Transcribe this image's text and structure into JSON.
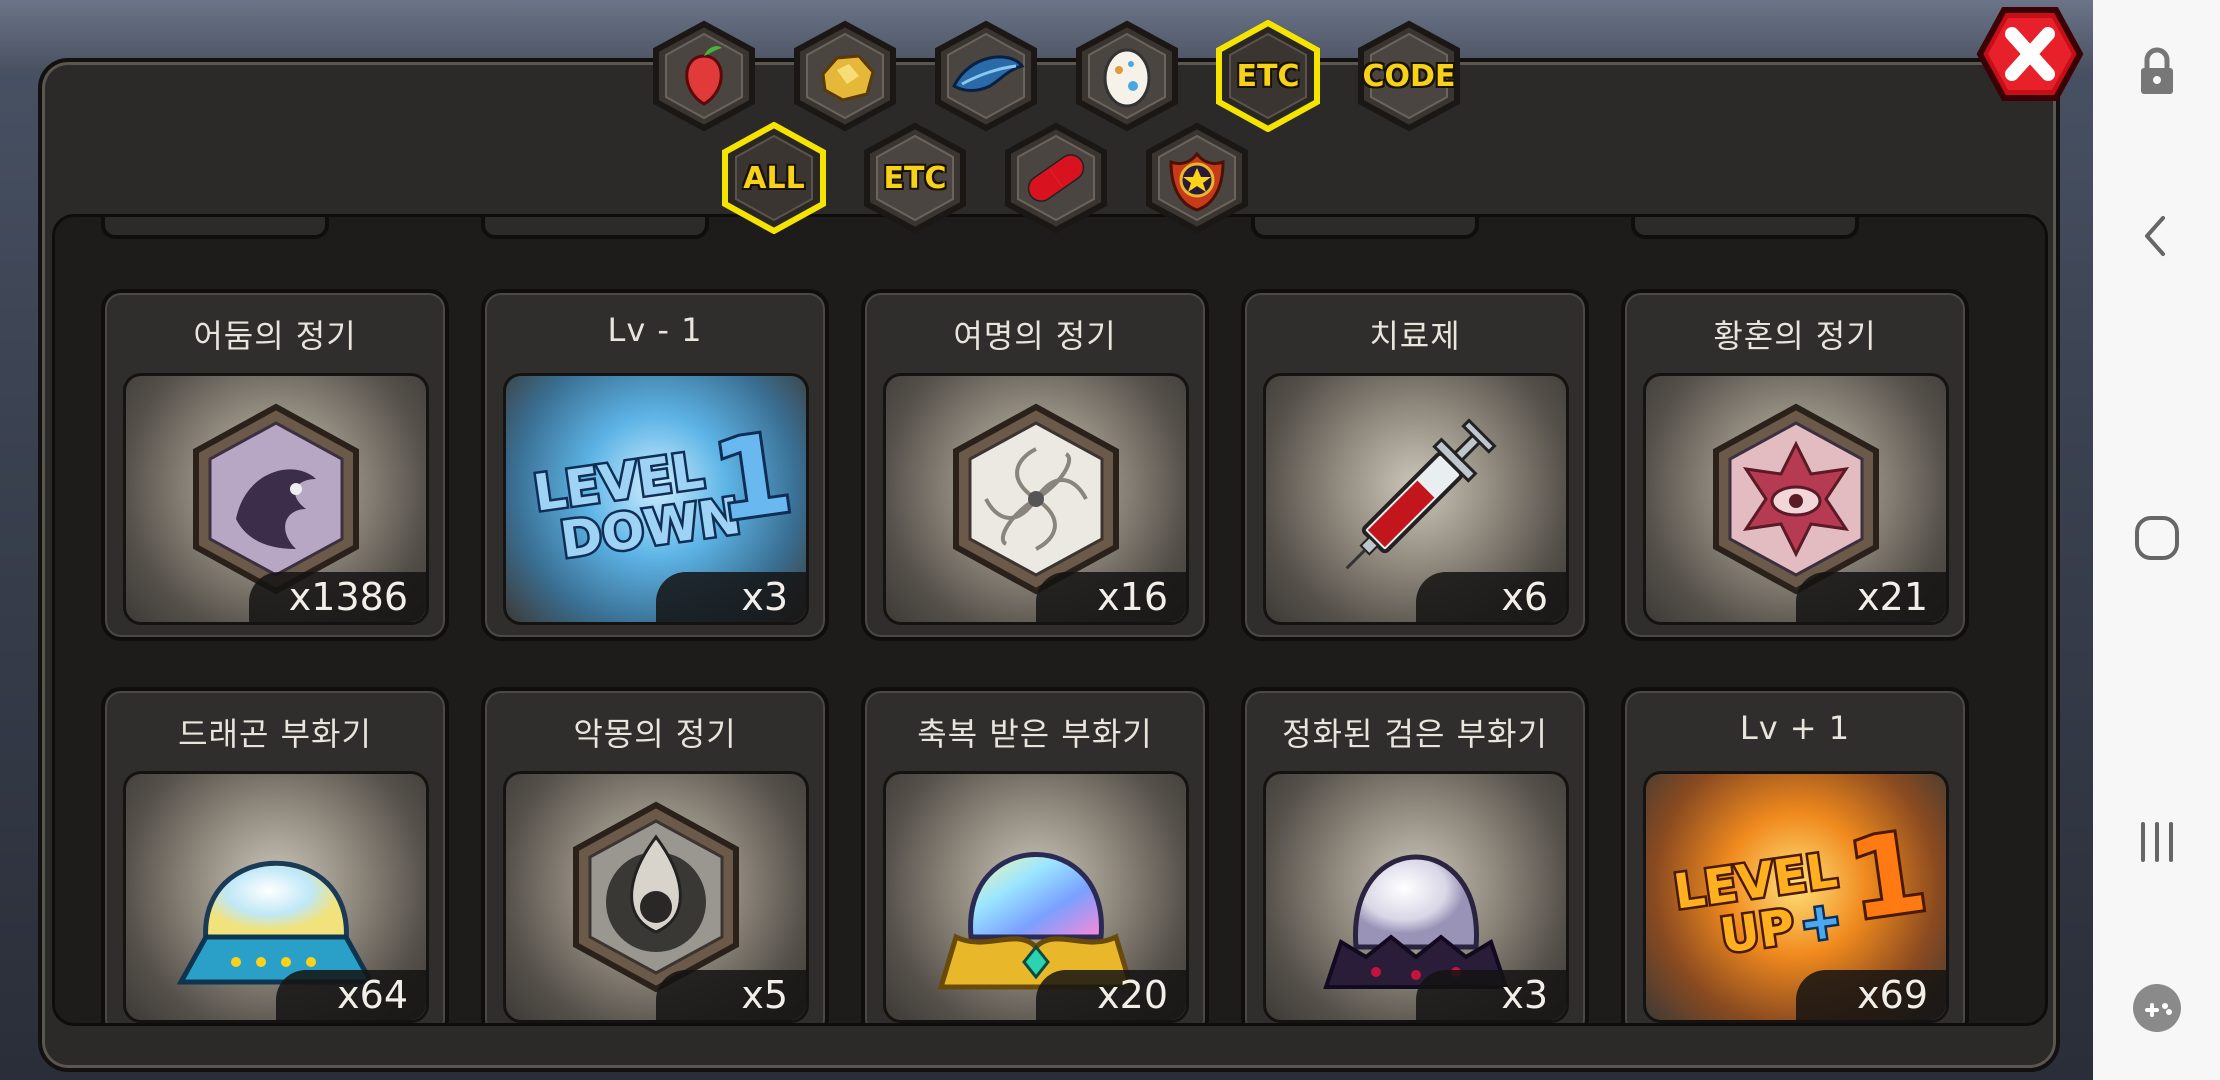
{
  "tabs_top": [
    {
      "id": "fruit",
      "label": "",
      "icon": "fruit-icon",
      "selected": false
    },
    {
      "id": "ore",
      "label": "",
      "icon": "ore-icon",
      "selected": false
    },
    {
      "id": "feather",
      "label": "",
      "icon": "feather-icon",
      "selected": false
    },
    {
      "id": "egg",
      "label": "",
      "icon": "egg-icon",
      "selected": false
    },
    {
      "id": "etc",
      "label": "ETC",
      "icon": "",
      "selected": true
    },
    {
      "id": "code",
      "label": "CODE",
      "icon": "",
      "selected": false
    }
  ],
  "tabs_sub": [
    {
      "id": "all",
      "label": "ALL",
      "icon": "",
      "selected": true
    },
    {
      "id": "etc",
      "label": "ETC",
      "icon": "",
      "selected": false
    },
    {
      "id": "pill",
      "label": "",
      "icon": "pill-icon",
      "selected": false
    },
    {
      "id": "badge",
      "label": "",
      "icon": "star-badge-icon",
      "selected": false
    }
  ],
  "items": [
    {
      "title": "어둠의 정기",
      "count": "x1386",
      "icon": "dark-essence-icon"
    },
    {
      "title": "Lv - 1",
      "count": "x3",
      "icon": "level-down-icon",
      "art_text": [
        "LEVEL",
        "DOWN",
        "1"
      ]
    },
    {
      "title": "여명의 정기",
      "count": "x16",
      "icon": "dawn-essence-icon"
    },
    {
      "title": "치료제",
      "count": "x6",
      "icon": "syringe-icon"
    },
    {
      "title": "황혼의 정기",
      "count": "x21",
      "icon": "twilight-essence-icon"
    },
    {
      "title": "드래곤 부화기",
      "count": "x64",
      "icon": "dragon-incubator-icon"
    },
    {
      "title": "악몽의 정기",
      "count": "x5",
      "icon": "nightmare-essence-icon"
    },
    {
      "title": "축복 받은 부화기",
      "count": "x20",
      "icon": "blessed-incubator-icon"
    },
    {
      "title": "정화된 검은 부화기",
      "count": "x3",
      "icon": "purified-black-incubator-icon"
    },
    {
      "title": "Lv + 1",
      "count": "x69",
      "icon": "level-up-icon",
      "art_text": [
        "LEVEL",
        "UP",
        "+",
        "1"
      ]
    }
  ],
  "colors": {
    "tab_selected_glow": "#f5e400",
    "tab_label": "#f7d21a",
    "close_red": "#d8121e",
    "panel": "#2b2a28"
  },
  "system_nav": [
    "lock-icon",
    "back-icon",
    "home-icon",
    "recents-icon",
    "game-tools-icon"
  ]
}
